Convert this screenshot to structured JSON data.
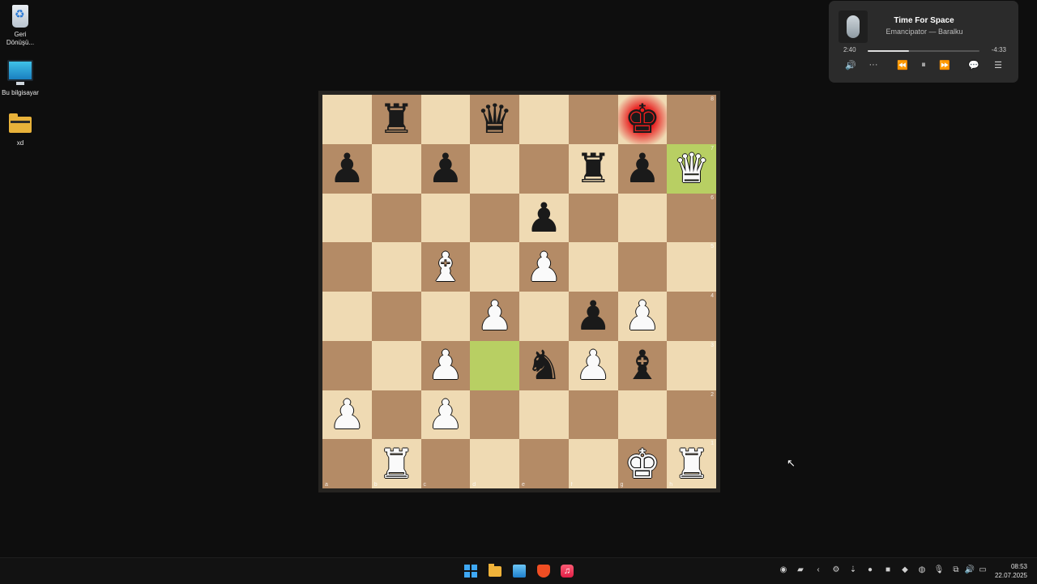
{
  "desktop": {
    "icons": [
      {
        "label": "Geri Dönüşü..."
      },
      {
        "label": "Bu bilgisayar"
      },
      {
        "label": "xd"
      }
    ]
  },
  "chess": {
    "ranks": [
      "8",
      "7",
      "6",
      "5",
      "4",
      "3",
      "2",
      "1"
    ],
    "files": [
      "a",
      "b",
      "c",
      "d",
      "e",
      "f",
      "g",
      "h"
    ],
    "board": [
      [
        null,
        {
          "c": "b",
          "t": "R",
          "name": "rook"
        },
        null,
        {
          "c": "b",
          "t": "Q",
          "name": "queen"
        },
        null,
        null,
        {
          "c": "b",
          "t": "K",
          "name": "king"
        },
        null
      ],
      [
        {
          "c": "b",
          "t": "P",
          "name": "pawn"
        },
        null,
        {
          "c": "b",
          "t": "P",
          "name": "pawn"
        },
        null,
        null,
        {
          "c": "b",
          "t": "R",
          "name": "rook"
        },
        {
          "c": "b",
          "t": "P",
          "name": "pawn"
        },
        {
          "c": "w",
          "t": "Q",
          "name": "queen"
        }
      ],
      [
        null,
        null,
        null,
        null,
        {
          "c": "b",
          "t": "P",
          "name": "pawn"
        },
        null,
        null,
        null
      ],
      [
        null,
        null,
        {
          "c": "w",
          "t": "B",
          "name": "bishop"
        },
        null,
        {
          "c": "w",
          "t": "P",
          "name": "pawn"
        },
        null,
        null,
        null
      ],
      [
        null,
        null,
        null,
        {
          "c": "w",
          "t": "P",
          "name": "pawn"
        },
        null,
        {
          "c": "b",
          "t": "P",
          "name": "pawn"
        },
        {
          "c": "w",
          "t": "P",
          "name": "pawn"
        },
        null
      ],
      [
        null,
        null,
        {
          "c": "w",
          "t": "P",
          "name": "pawn"
        },
        null,
        {
          "c": "b",
          "t": "N",
          "name": "knight"
        },
        {
          "c": "w",
          "t": "P",
          "name": "pawn"
        },
        {
          "c": "b",
          "t": "B",
          "name": "bishop"
        },
        null
      ],
      [
        {
          "c": "w",
          "t": "P",
          "name": "pawn"
        },
        null,
        {
          "c": "w",
          "t": "P",
          "name": "pawn"
        },
        null,
        null,
        null,
        null,
        null
      ],
      [
        null,
        {
          "c": "w",
          "t": "R",
          "name": "rook"
        },
        null,
        null,
        null,
        null,
        {
          "c": "w",
          "t": "K",
          "name": "king"
        },
        {
          "c": "w",
          "t": "R",
          "name": "rook"
        }
      ]
    ],
    "highlighted_squares": [
      "d3",
      "h7"
    ],
    "check_square": "g8"
  },
  "media": {
    "title": "Time For Space",
    "artist": "Emancipator — Baralku",
    "elapsed": "2:40",
    "remaining": "-4:33",
    "progress_fraction": 0.37,
    "controls": [
      {
        "name": "volume-icon",
        "glyph": "🔊"
      },
      {
        "name": "more-options-icon",
        "glyph": "···"
      },
      {
        "name": "previous-icon",
        "glyph": "⏪"
      },
      {
        "name": "pause-icon",
        "glyph": "⏸"
      },
      {
        "name": "next-icon",
        "glyph": "⏩"
      },
      {
        "name": "lyrics-icon",
        "glyph": "💬"
      },
      {
        "name": "queue-icon",
        "glyph": "☰"
      }
    ]
  },
  "taskbar": {
    "time": "08:53",
    "date": "22.07.2025",
    "tray_icons": [
      {
        "name": "tray-app-icon-1",
        "glyph": "◉"
      },
      {
        "name": "tray-nvidia-icon",
        "glyph": "▰"
      },
      {
        "name": "tray-chevron-icon",
        "glyph": "‹"
      },
      {
        "name": "tray-settings-icon",
        "glyph": "⚙"
      },
      {
        "name": "tray-download-icon",
        "glyph": "⇣"
      },
      {
        "name": "tray-app-icon-2",
        "glyph": "●"
      },
      {
        "name": "tray-app-icon-3",
        "glyph": "■"
      },
      {
        "name": "tray-app-icon-4",
        "glyph": "◆"
      },
      {
        "name": "tray-edge-icon",
        "glyph": "◍"
      },
      {
        "name": "tray-mic-icon",
        "glyph": "🎙"
      },
      {
        "name": "tray-network-icon",
        "glyph": "⧉"
      },
      {
        "name": "tray-volume-icon",
        "glyph": "🔊"
      },
      {
        "name": "tray-battery-icon",
        "glyph": "▭"
      }
    ]
  }
}
